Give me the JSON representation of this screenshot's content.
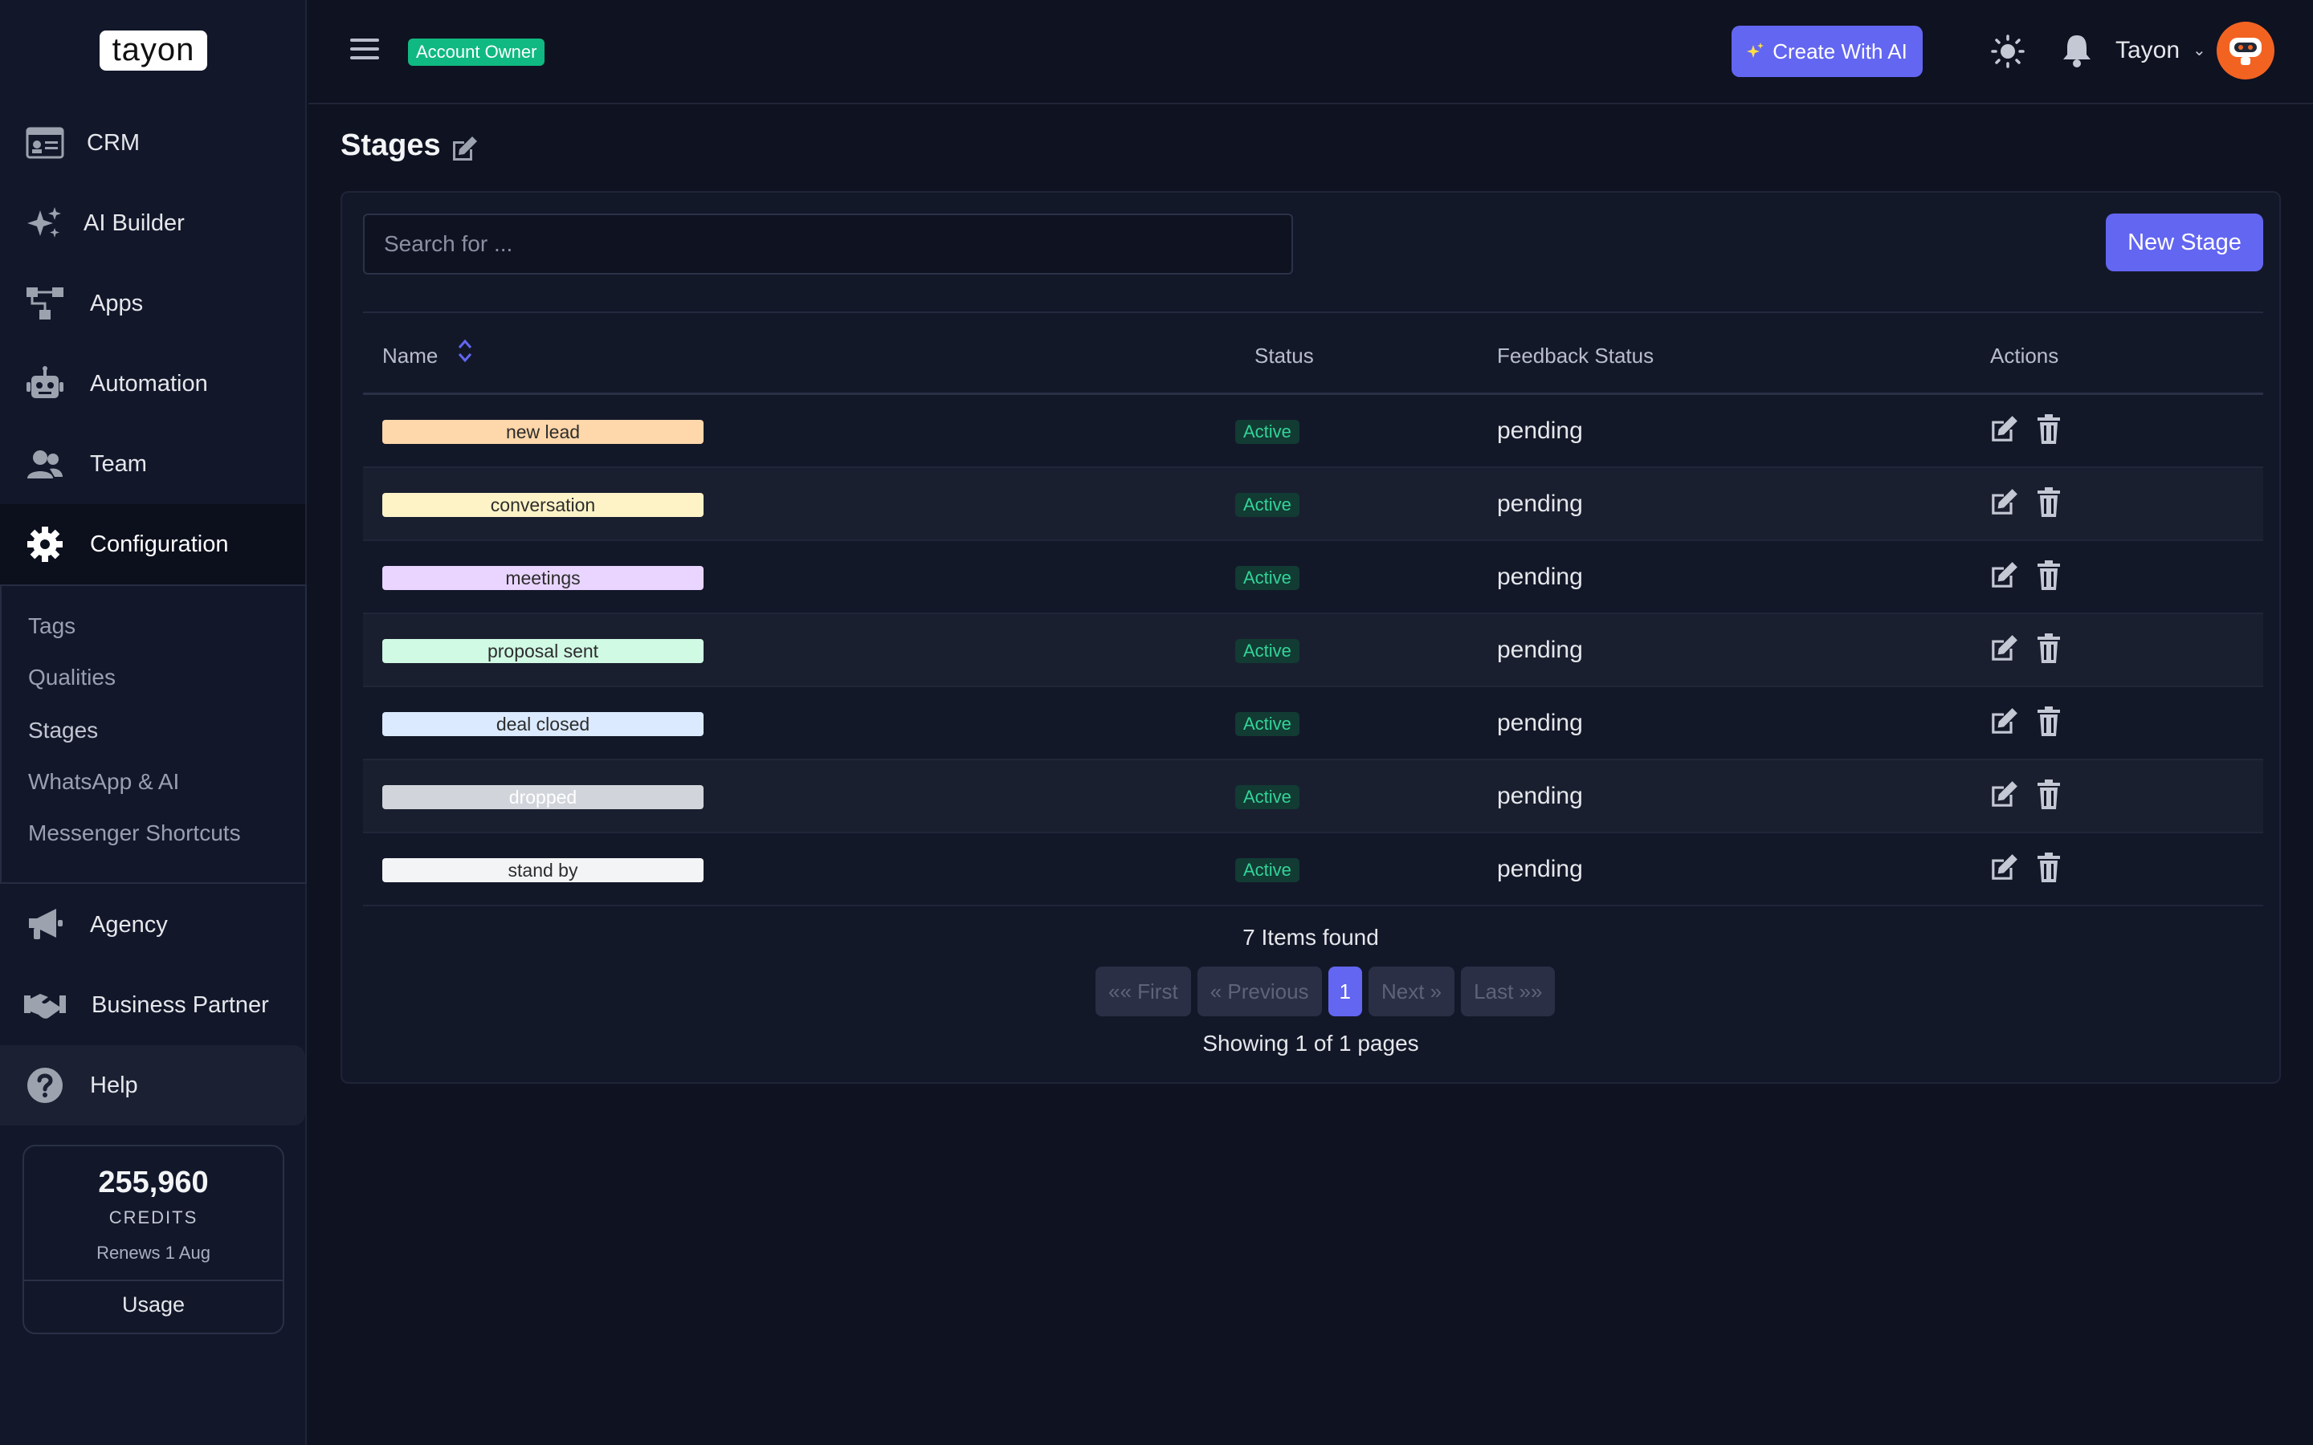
{
  "brand": {
    "logo_text": "tayon"
  },
  "sidebar": {
    "items": [
      {
        "id": "crm",
        "label": "CRM",
        "icon": "id-card-icon"
      },
      {
        "id": "ai-builder",
        "label": "AI Builder",
        "icon": "sparkles-icon"
      },
      {
        "id": "apps",
        "label": "Apps",
        "icon": "sitemap-icon"
      },
      {
        "id": "automation",
        "label": "Automation",
        "icon": "robot-icon"
      },
      {
        "id": "team",
        "label": "Team",
        "icon": "users-icon"
      },
      {
        "id": "configuration",
        "label": "Configuration",
        "icon": "gear-icon",
        "active": true
      },
      {
        "id": "agency",
        "label": "Agency",
        "icon": "megaphone-icon"
      },
      {
        "id": "business-partner",
        "label": "Business Partner",
        "icon": "handshake-icon"
      },
      {
        "id": "help",
        "label": "Help",
        "icon": "question-circle-icon"
      }
    ],
    "submenu": [
      "Tags",
      "Qualities",
      "Stages",
      "WhatsApp & AI",
      "Messenger Shortcuts"
    ],
    "credits": {
      "value": "255,960",
      "label": "CREDITS",
      "renews": "Renews 1 Aug",
      "usage_label": "Usage"
    }
  },
  "header": {
    "role_badge": "Account Owner",
    "create_ai_label": "Create With AI",
    "user_name": "Tayon"
  },
  "page": {
    "title": "Stages",
    "search_placeholder": "Search for ...",
    "new_button": "New Stage",
    "columns": {
      "name": "Name",
      "status": "Status",
      "feedback": "Feedback Status",
      "actions": "Actions"
    },
    "rows": [
      {
        "name": "new lead",
        "color": "#fed7aa",
        "text_color": "#2d2d2d",
        "status": "Active",
        "feedback": "pending"
      },
      {
        "name": "conversation",
        "color": "#fef3c7",
        "text_color": "#2d2d2d",
        "status": "Active",
        "feedback": "pending"
      },
      {
        "name": "meetings",
        "color": "#e9d5ff",
        "text_color": "#2d2d2d",
        "status": "Active",
        "feedback": "pending"
      },
      {
        "name": "proposal sent",
        "color": "#d1fae5",
        "text_color": "#2d2d2d",
        "status": "Active",
        "feedback": "pending"
      },
      {
        "name": "deal closed",
        "color": "#dbeafe",
        "text_color": "#2d2d2d",
        "status": "Active",
        "feedback": "pending"
      },
      {
        "name": "dropped",
        "color": "#d1d5db",
        "text_color": "#ffffff",
        "status": "Active",
        "feedback": "pending"
      },
      {
        "name": "stand by",
        "color": "#f3f4f6",
        "text_color": "#2d2d2d",
        "status": "Active",
        "feedback": "pending"
      }
    ],
    "items_found": "7 Items found",
    "pagination": {
      "first": "«« First",
      "previous": "« Previous",
      "current": "1",
      "next": "Next »",
      "last": "Last »»"
    },
    "showing": "Showing 1 of 1 pages"
  },
  "colors": {
    "accent": "#6366f1",
    "success": "#10b981",
    "avatar": "#f26322",
    "background": "#0f1221"
  }
}
